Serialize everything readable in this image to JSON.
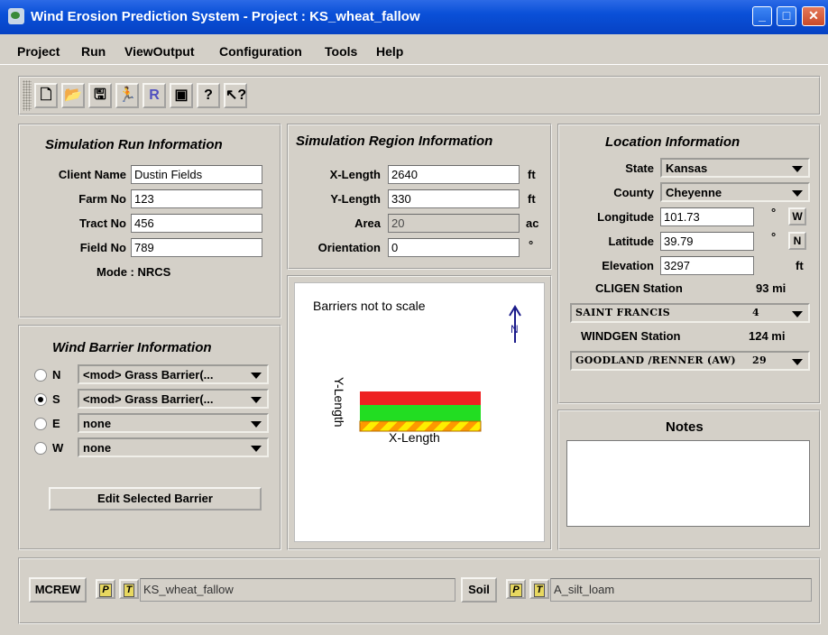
{
  "window": {
    "title": "Wind Erosion Prediction System - Project : KS_wheat_fallow"
  },
  "menu": [
    "Project",
    "Run",
    "ViewOutput",
    "Configuration",
    "Tools",
    "Help"
  ],
  "toolbar": [
    {
      "icon": "new-document-icon"
    },
    {
      "icon": "open-folder-icon"
    },
    {
      "icon": "save-icon"
    },
    {
      "icon": "run-icon"
    },
    {
      "icon": "report-icon"
    },
    {
      "icon": "screen-capture-icon"
    },
    {
      "icon": "help-icon"
    },
    {
      "icon": "context-help-icon"
    }
  ],
  "simulation_run": {
    "title": "Simulation Run Information",
    "client_name_label": "Client Name",
    "client_name": "Dustin Fields",
    "farm_no_label": "Farm No",
    "farm_no": "123",
    "tract_no_label": "Tract No",
    "tract_no": "456",
    "field_no_label": "Field No",
    "field_no": "789",
    "mode": "Mode : NRCS"
  },
  "simulation_region": {
    "title": "Simulation Region Information",
    "x_length_label": "X-Length",
    "x_length": "2640",
    "x_unit": "ft",
    "y_length_label": "Y-Length",
    "y_length": "330",
    "y_unit": "ft",
    "area_label": "Area",
    "area": "20",
    "area_unit": "ac",
    "orientation_label": "Orientation",
    "orientation": "0",
    "orientation_unit": "°"
  },
  "location": {
    "title": "Location Information",
    "state_label": "State",
    "state": "Kansas",
    "county_label": "County",
    "county": "Cheyenne",
    "longitude_label": "Longitude",
    "longitude": "101.73",
    "longitude_dir": "W",
    "latitude_label": "Latitude",
    "latitude": "39.79",
    "latitude_dir": "N",
    "degree_symbol": "°",
    "elevation_label": "Elevation",
    "elevation": "3297",
    "elevation_unit": "ft",
    "cligen_label": "CLIGEN Station",
    "cligen_distance": "93 mi",
    "cligen_station": "SAINT FRANCIS",
    "cligen_station_no": "4",
    "windgen_label": "WINDGEN Station",
    "windgen_distance": "124 mi",
    "windgen_station": "GOODLAND /RENNER (AW)",
    "windgen_station_no": "29"
  },
  "wind_barrier": {
    "title": "Wind Barrier Information",
    "rows": [
      {
        "dir": "N",
        "value": "<mod> Grass Barrier(...",
        "selected": false
      },
      {
        "dir": "S",
        "value": "<mod> Grass Barrier(...",
        "selected": true
      },
      {
        "dir": "E",
        "value": "none",
        "selected": false
      },
      {
        "dir": "W",
        "value": "none",
        "selected": false
      }
    ],
    "edit_button": "Edit Selected Barrier"
  },
  "barrier_canvas": {
    "note": "Barriers not to scale",
    "north_label": "N",
    "y_axis_label": "Y-Length",
    "x_axis_label": "X-Length",
    "colors": {
      "red": "#ee2222",
      "green": "#22dd22",
      "orange": "#ff9900",
      "yellow": "#ffee00",
      "arrow": "#1a1a8a"
    }
  },
  "notes": {
    "title": "Notes",
    "text": ""
  },
  "bottom": {
    "mcrew_label": "MCREW",
    "mcrew_file": "KS_wheat_fallow",
    "soil_label": "Soil",
    "soil_file": "A_silt_loam",
    "p_label": "P",
    "t_label": "T"
  }
}
